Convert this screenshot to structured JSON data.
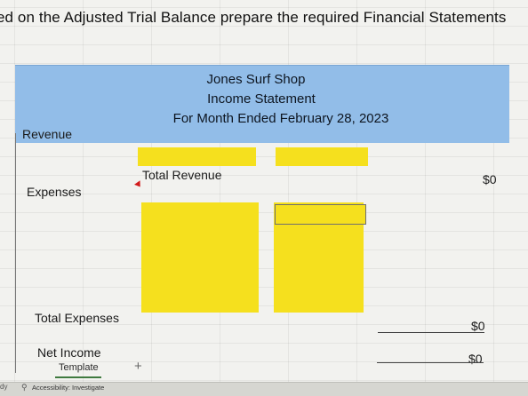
{
  "instruction": "ed on the Adjusted Trial Balance prepare the required Financial Statements",
  "statement": {
    "company": "Jones Surf Shop",
    "title": "Income Statement",
    "period": "For Month Ended February 28, 2023"
  },
  "rows": {
    "revenue": "Revenue",
    "total_revenue": "Total Revenue",
    "total_revenue_value": "$0",
    "expenses": "Expenses",
    "total_expenses": "Total Expenses",
    "total_expenses_value": "$0",
    "net_income": "Net Income",
    "net_income_value": "$0"
  },
  "footer": {
    "sheet_tab": "Template",
    "add_sheet": "+",
    "status_left": "dy",
    "accessibility": "Accessibility: Investigate"
  },
  "colors": {
    "header_blue": "#92bde8",
    "input_yellow": "#f5e01e"
  }
}
